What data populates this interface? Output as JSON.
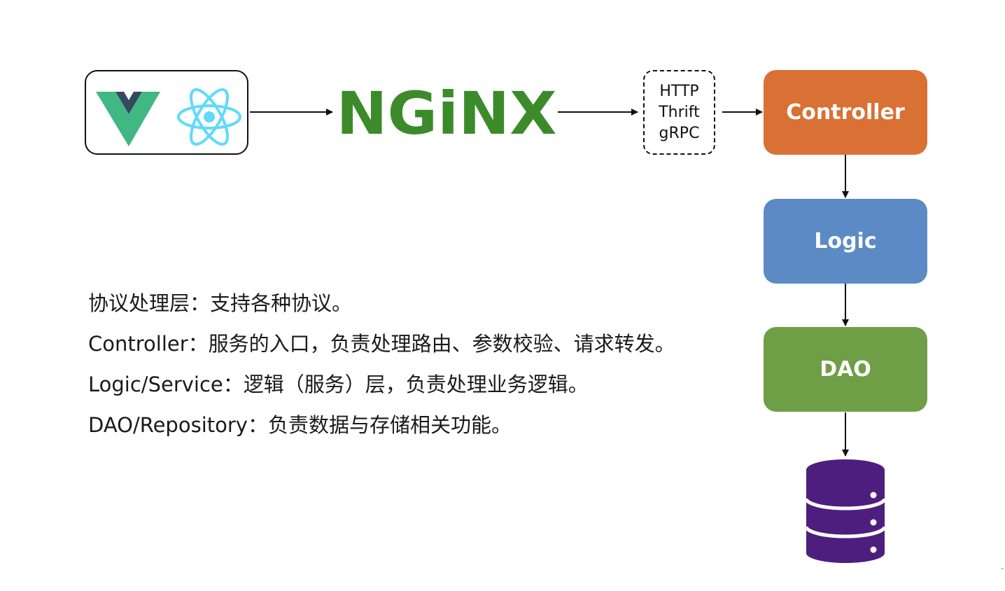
{
  "diagram": {
    "frontend": {
      "icons": [
        "vue-logo-icon",
        "react-logo-icon"
      ]
    },
    "proxy": {
      "logo_text": "NGiNX",
      "color": "#3C8B2B"
    },
    "protocols": [
      "HTTP",
      "Thrift",
      "gRPC"
    ],
    "layers": [
      {
        "label": "Controller",
        "color": "#D97034"
      },
      {
        "label": "Logic",
        "color": "#5B8AC5"
      },
      {
        "label": "DAO",
        "color": "#6E9E45"
      }
    ],
    "storage": {
      "icon": "database-icon",
      "color": "#4E1E7E"
    }
  },
  "descriptions": [
    "协议处理层：支持各种协议。",
    "Controller：服务的入口，负责处理路由、参数校验、请求转发。",
    "Logic/Service：逻辑（服务）层，负责处理业务逻辑。",
    "DAO/Repository：负责数据与存储相关功能。"
  ],
  "footer": {
    "mark": "-"
  }
}
